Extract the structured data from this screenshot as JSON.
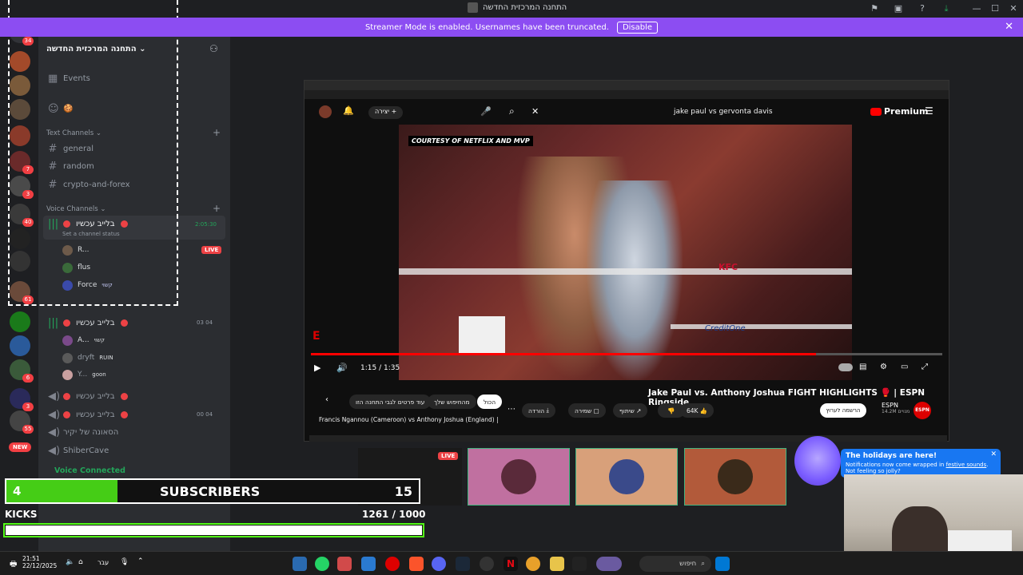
{
  "window": {
    "title": "התחנה המרכזית החדשה"
  },
  "banner": {
    "message": "Streamer Mode is enabled. Usernames have been truncated.",
    "disable_label": "Disable"
  },
  "rail": {
    "badges": [
      "34",
      "7",
      "3",
      "40",
      "61",
      "6",
      "3",
      "55"
    ],
    "new_label": "NEW"
  },
  "server": {
    "name": "התחנה המרכזית החדשה",
    "events_label": "Events",
    "text_category": "Text Channels",
    "text_channels": [
      "general",
      "random",
      "crypto-and-forex"
    ],
    "voice_category": "Voice Channels",
    "voice_channels": [
      {
        "name": "בלייב עכשיו",
        "timer": "2:05:30",
        "status": "Set a channel status",
        "users": [
          {
            "name": "R...",
            "badge": "LIVE"
          },
          {
            "name": "flus"
          },
          {
            "name": "Force",
            "tag": "קשוי"
          }
        ]
      },
      {
        "name": "בלייב עכשיו",
        "counts": [
          "03",
          "04"
        ],
        "users": [
          {
            "name": "A...",
            "tag": "קשוי"
          },
          {
            "name": "dryft",
            "tag": "RUIN"
          },
          {
            "name": "Y...",
            "tag": "goon"
          }
        ]
      },
      {
        "name": "בלייב עכשיו"
      },
      {
        "name": "בלייב עכשיו",
        "counts": [
          "00",
          "04"
        ]
      },
      {
        "name": "הסאונה של יקיר"
      },
      {
        "name": "ShiberCave"
      }
    ],
    "voice_connected": "Voice Connected"
  },
  "video": {
    "search_query": "jake paul vs gervonta davis",
    "create_label": "יצירה",
    "premium_label": "Premium",
    "courtesy_tag": "COURTESY OF NETFLIX AND MVP",
    "time": "1:15 / 1:35",
    "progress": 0.8,
    "title": "Jake Paul vs. Anthony Joshua FIGHT HIGHLIGHTS 🥊 | ESPN Ringside",
    "likes": "64K",
    "share_label": "שיתוף",
    "save_label": "שמירה",
    "download_label": "הורדה",
    "subscribe_label": "הרשמה לערוץ",
    "channel_name": "ESPN",
    "channel_subs": "14.2M מנויים",
    "chips": [
      "הכול",
      "מהחיפוש שלך",
      "עוד פרטים לגבי התחנה הזו"
    ],
    "related_title": "Francis Ngannou (Cameroon) vs Anthony Joshua (England) |",
    "ring_sponsor": "KFC",
    "ring_sponsor2": "CreditOne"
  },
  "overlay": {
    "live_label": "LIVE",
    "subs_current": "4",
    "subs_label": "SUBSCRIBERS",
    "subs_goal": "15",
    "kicks_label": "KICKS",
    "kicks_value": "1261 / 1000",
    "kicks_progress": 1.0,
    "subs_progress": 0.27
  },
  "popup": {
    "title": "The holidays are here!",
    "body_prefix": "Notifications now come wrapped in ",
    "body_link": "festive sounds",
    "body_suffix": ". Not feeling so jolly?"
  },
  "taskbar": {
    "time": "21:51",
    "date": "22/12/2025",
    "lang": "עבר",
    "search": "חיפוש"
  },
  "colors": {
    "banner": "#8c4df2",
    "kick_green": "#53fc18",
    "live_red": "#ed4245",
    "yt_red": "#ff0000"
  }
}
